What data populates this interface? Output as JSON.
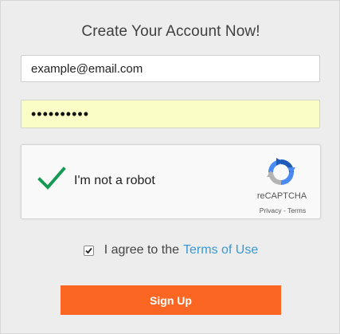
{
  "form": {
    "title": "Create Your Account Now!",
    "email_value": "example@email.com",
    "password_mask": "••••••••••"
  },
  "captcha": {
    "label": "I'm not a robot",
    "brand": "reCAPTCHA",
    "privacy_link": "Privacy",
    "separator": " - ",
    "terms_link": "Terms",
    "checked": true,
    "check_color": "#159a55"
  },
  "agreement": {
    "prefix": "I agree to the",
    "link_text": "Terms of Use",
    "checked": true,
    "link_color": "#3a99d3"
  },
  "submit": {
    "label": "Sign Up",
    "color": "#fb6623"
  },
  "icons": {
    "captcha_check": "check-icon",
    "recaptcha_logo": "recaptcha-logo-icon",
    "agree_checkbox": "checkbox-checked-icon"
  }
}
